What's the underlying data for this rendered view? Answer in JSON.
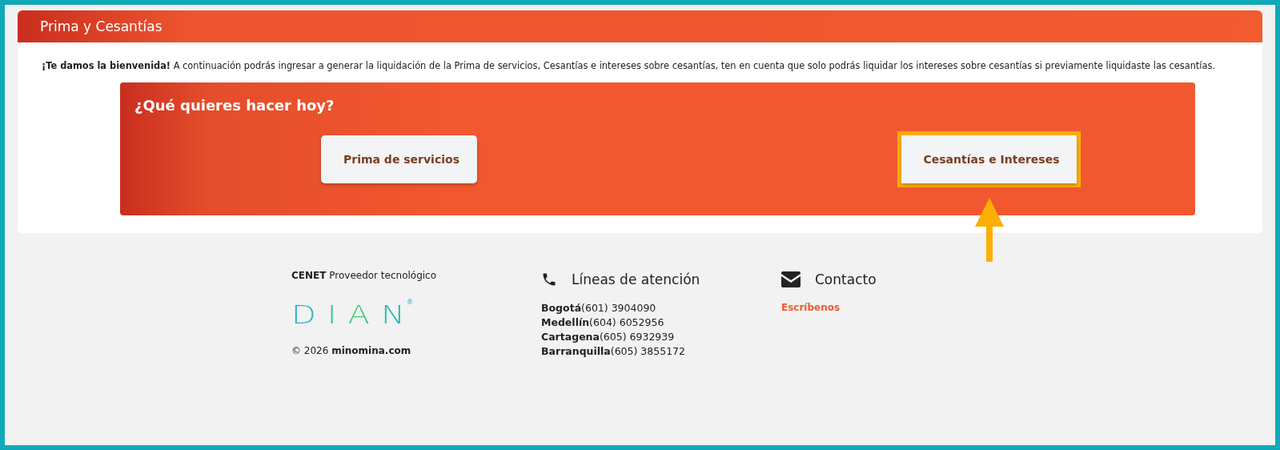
{
  "card": {
    "title": "Prima y Cesantías",
    "intro": "**¡Te damos la bienvenida!** A continuación podrás ingresar a generar la liquidación de la Prima de servicios, Cesantías e intereses sobre cesantías, ten en cuenta que solo podrás liquidar los intereses sobre cesantías si previamente liquidaste las cesantías."
  },
  "panel": {
    "heading": "¿Qué quieres hacer hoy?",
    "options": [
      {
        "label": "Prima de servicios",
        "highlighted": false
      },
      {
        "label": "Cesantías e Intereses",
        "highlighted": true
      }
    ]
  },
  "footer": {
    "provider": "**CENET** Proveedor tecnológico",
    "logo": "DIAN",
    "logo_mark": "®",
    "copyright": "© 2026 **minomina.com**",
    "phones_title": "Líneas de atención",
    "phones": [
      {
        "city": "Bogotá",
        "number": "(601) 3904090"
      },
      {
        "city": "Medellín",
        "number": "(604) 6052956"
      },
      {
        "city": "Cartagena",
        "number": "(605) 6932939"
      },
      {
        "city": "Barranquilla",
        "number": "(605) 3855172"
      }
    ],
    "contact_title": "Contacto",
    "contact_link": "Escríbenos"
  }
}
